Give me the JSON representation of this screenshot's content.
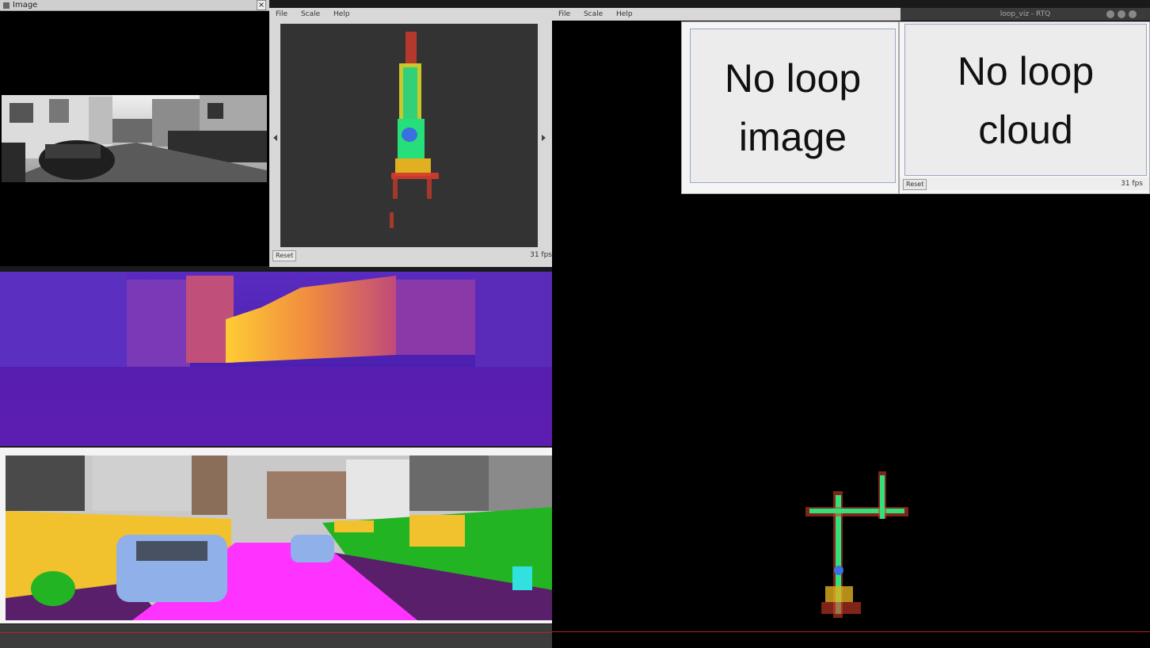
{
  "image_window": {
    "title": "Image",
    "close_glyph": "×"
  },
  "viewer_left": {
    "menu": [
      "File",
      "Scale",
      "Help"
    ],
    "reset_label": "Reset",
    "fps": "31 fps"
  },
  "viewer_right": {
    "menu": [
      "File",
      "Scale",
      "Help"
    ],
    "titlebar_text": "loop_viz - RTQ"
  },
  "loop_image_panel": {
    "line1": "No loop",
    "line2": "image"
  },
  "loop_cloud_panel": {
    "line1": "No loop",
    "line2": "cloud",
    "reset_label": "Reset",
    "fps": "31 fps"
  },
  "colors": {
    "depth_map_high": "#ffcc33",
    "depth_map_low": "#3a1a8a",
    "sky_gray": "#c9c9c9",
    "road_magenta": "#ff33ff",
    "building_yellow": "#f2c12e",
    "vegetation_green": "#22b422",
    "car_blue": "#8fb0e8",
    "sidewalk_purple": "#5a1f6a",
    "viewer_bg": "#333333"
  }
}
